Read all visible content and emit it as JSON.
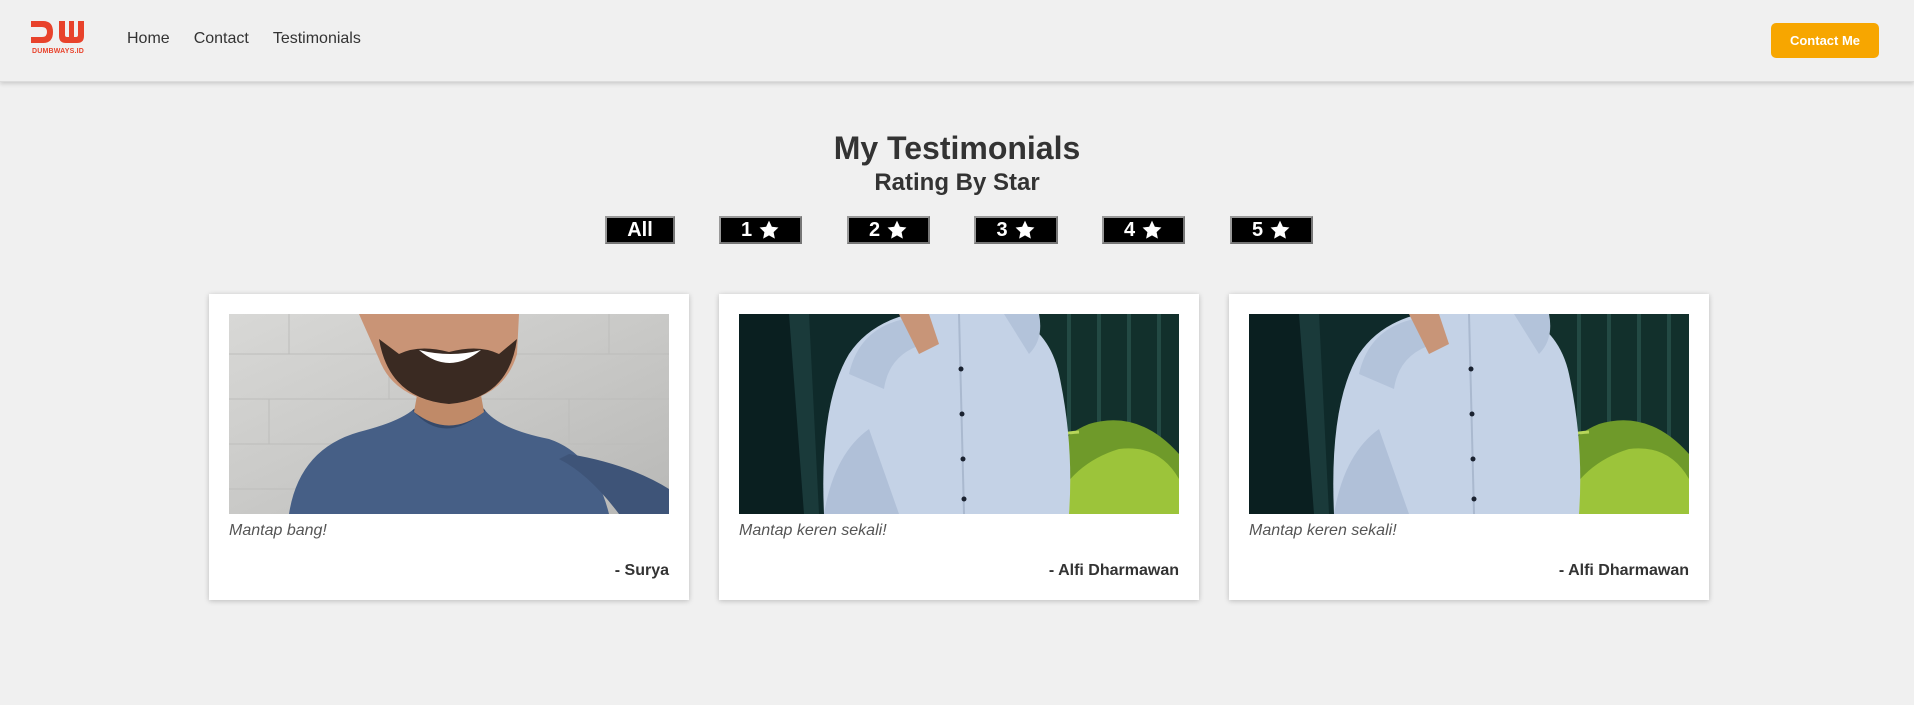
{
  "brand": {
    "logo_text": "DUMBWAYS.ID",
    "accent_color": "#e8422b"
  },
  "nav": {
    "links": [
      "Home",
      "Contact",
      "Testimonials"
    ],
    "contact_button": "Contact Me",
    "contact_button_color": "#f7a600"
  },
  "header": {
    "title": "My Testimonials",
    "subtitle": "Rating By Star"
  },
  "filters": [
    {
      "label": "All",
      "icon": ""
    },
    {
      "label": "1",
      "icon": "star-icon"
    },
    {
      "label": "2",
      "icon": "star-icon"
    },
    {
      "label": "3",
      "icon": "star-icon"
    },
    {
      "label": "4",
      "icon": "star-icon"
    },
    {
      "label": "5",
      "icon": "star-icon"
    }
  ],
  "testimonials": [
    {
      "quote": "Mantap bang!",
      "author": "- Surya",
      "image": "smiling-man-photo"
    },
    {
      "quote": "Mantap keren sekali!",
      "author": "- Alfi Dharmawan",
      "image": "man-in-shirt-photo"
    },
    {
      "quote": "Mantap keren sekali!",
      "author": "- Alfi Dharmawan",
      "image": "man-in-shirt-photo"
    }
  ]
}
